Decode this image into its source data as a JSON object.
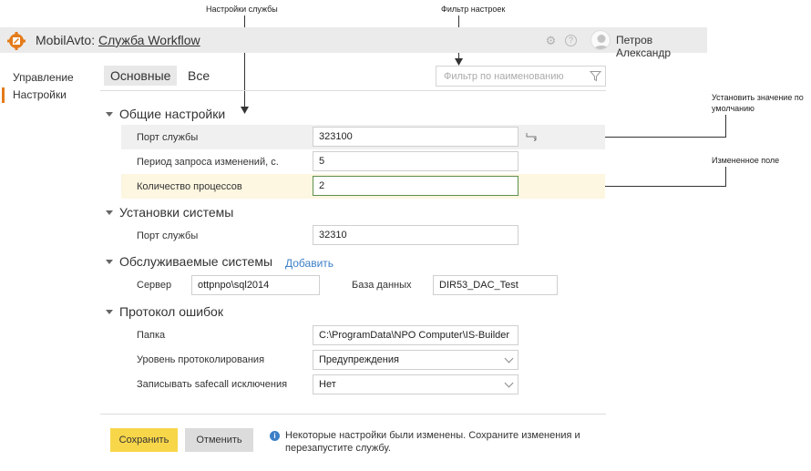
{
  "annotations": {
    "settings": "Настройки службы",
    "filter": "Фильтр настроек",
    "default": "Установить значение по умолчанию",
    "changed": "Измененное поле"
  },
  "header": {
    "app_name": "MobilAvto:",
    "service_name": "Служба Workflow",
    "user_name": "Петров Александр"
  },
  "sidebar": {
    "items": [
      {
        "label": "Управление"
      },
      {
        "label": "Настройки"
      }
    ]
  },
  "tabs": [
    {
      "label": "Основные"
    },
    {
      "label": "Все"
    }
  ],
  "filter": {
    "placeholder": "Фильтр по наименованию"
  },
  "sections": {
    "general": {
      "title": "Общие настройки",
      "fields": [
        {
          "label": "Порт службы",
          "value": "323100"
        },
        {
          "label": "Период запроса изменений, с.",
          "value": "5"
        },
        {
          "label": "Количество процессов",
          "value": "2"
        }
      ]
    },
    "system": {
      "title": "Установки системы",
      "fields": [
        {
          "label": "Порт службы",
          "value": "32310"
        }
      ]
    },
    "served": {
      "title": "Обслуживаемые системы",
      "add_label": "Добавить",
      "server_label": "Сервер",
      "server_value": "ottpnpo\\sql2014",
      "db_label": "База данных",
      "db_value": "DIR53_DAC_Test"
    },
    "errors": {
      "title": "Протокол ошибок",
      "fields": [
        {
          "label": "Папка",
          "value": "C:\\ProgramData\\NPO Computer\\IS-Builder"
        },
        {
          "label": "Уровень протоколирования",
          "value": "Предупреждения"
        },
        {
          "label": "Записывать safecall исключения",
          "value": "Нет"
        }
      ]
    }
  },
  "footer": {
    "save_label": "Сохранить",
    "cancel_label": "Отменить",
    "info_text": "Некоторые настройки были изменены. Сохраните изменения и перезапустите службу."
  },
  "colors": {
    "accent": "#e47b1a",
    "save_button": "#f8d64a",
    "link": "#3c7fc7",
    "changed_border": "#5d8f4e",
    "changed_row": "#fdf6e0"
  }
}
